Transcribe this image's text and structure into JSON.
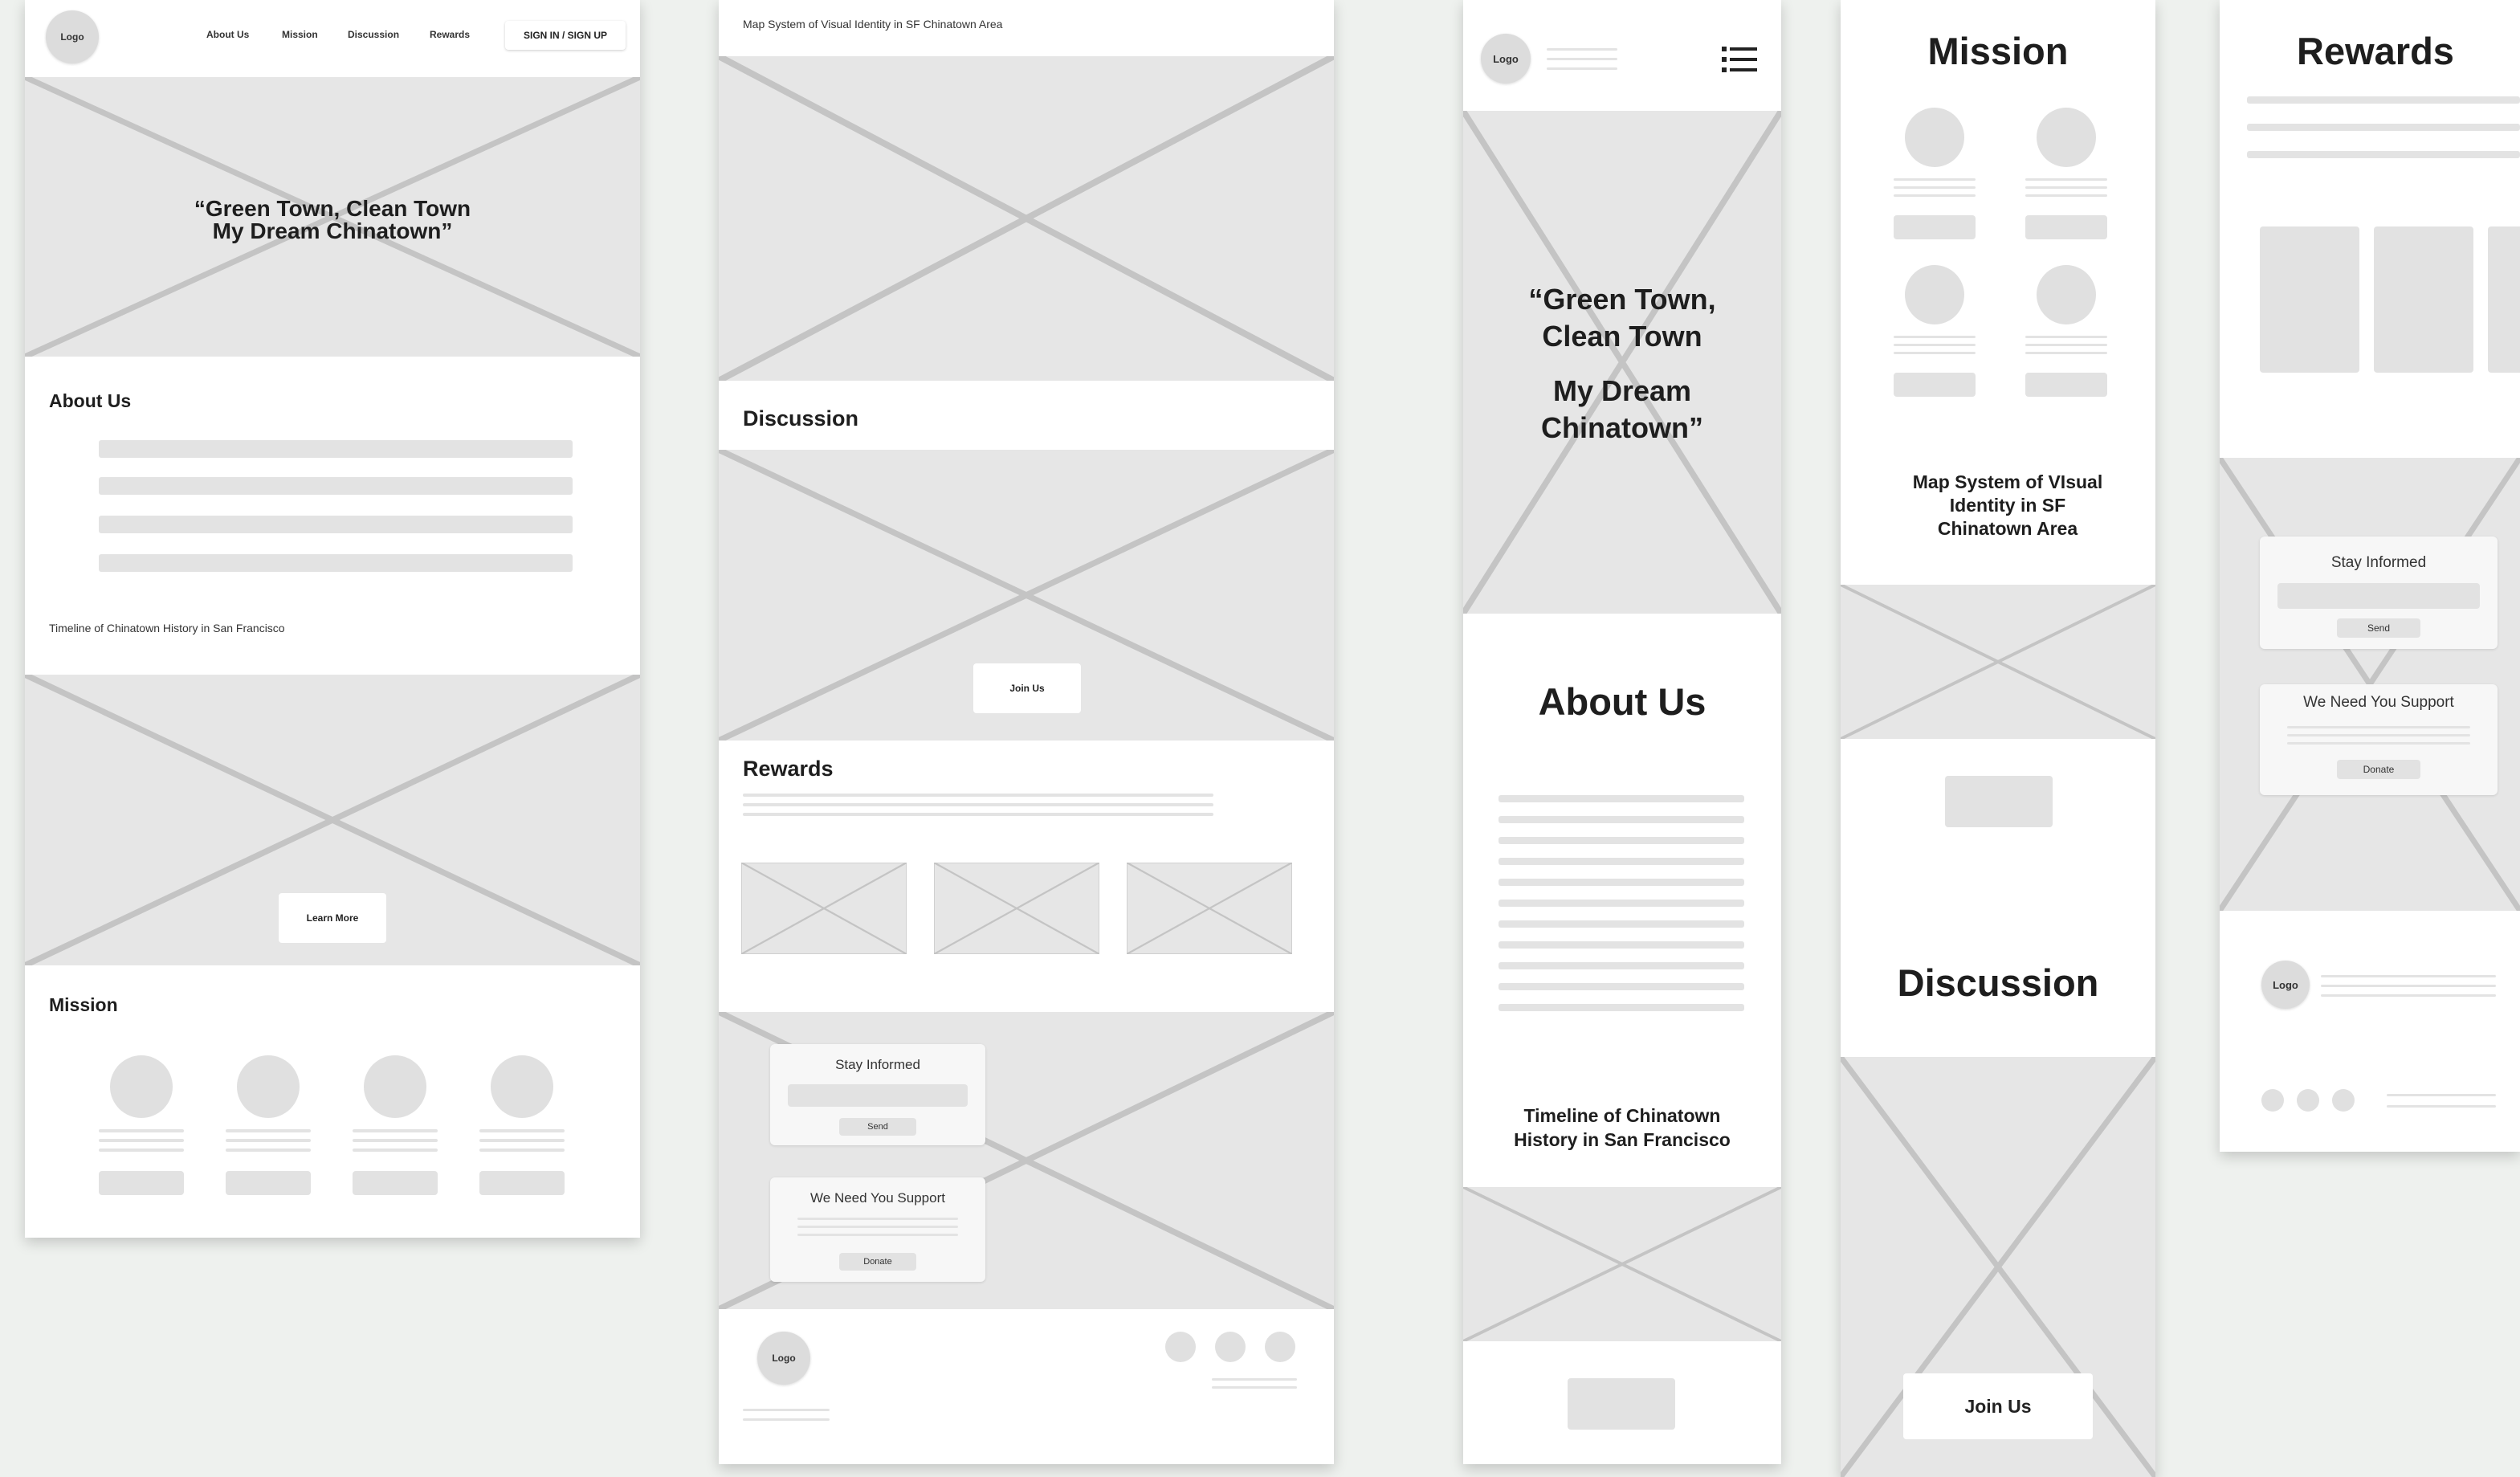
{
  "logo": "Logo",
  "nav": {
    "about": "About Us",
    "mission": "Mission",
    "discussion": "Discussion",
    "rewards": "Rewards",
    "signin": "SIGN IN / SIGN UP"
  },
  "hero": {
    "line1": "“Green Town, Clean Town",
    "line2": "My Dream Chinatown”"
  },
  "mobile_hero": {
    "line1": "“Green Town,",
    "line2": "Clean Town",
    "line3": "My Dream",
    "line4": "Chinatown”"
  },
  "sections": {
    "about": "About Us",
    "mission": "Mission",
    "discussion": "Discussion",
    "rewards": "Rewards"
  },
  "timeline": "Timeline of Chinatown History in San Francisco",
  "timeline_mobile": {
    "line1": "Timeline of Chinatown",
    "line2": "History in San Francisco"
  },
  "map_title": "Map System of Visual Identity in SF Chinatown Area",
  "map_title_mobile": {
    "line1": "Map System of VIsual",
    "line2": "Identity in SF",
    "line3": "Chinatown Area"
  },
  "buttons": {
    "learn_more": "Learn More",
    "join_us": "Join Us",
    "send": "Send",
    "donate": "Donate"
  },
  "cards": {
    "stay_informed": "Stay Informed",
    "support": "We Need You Support"
  }
}
